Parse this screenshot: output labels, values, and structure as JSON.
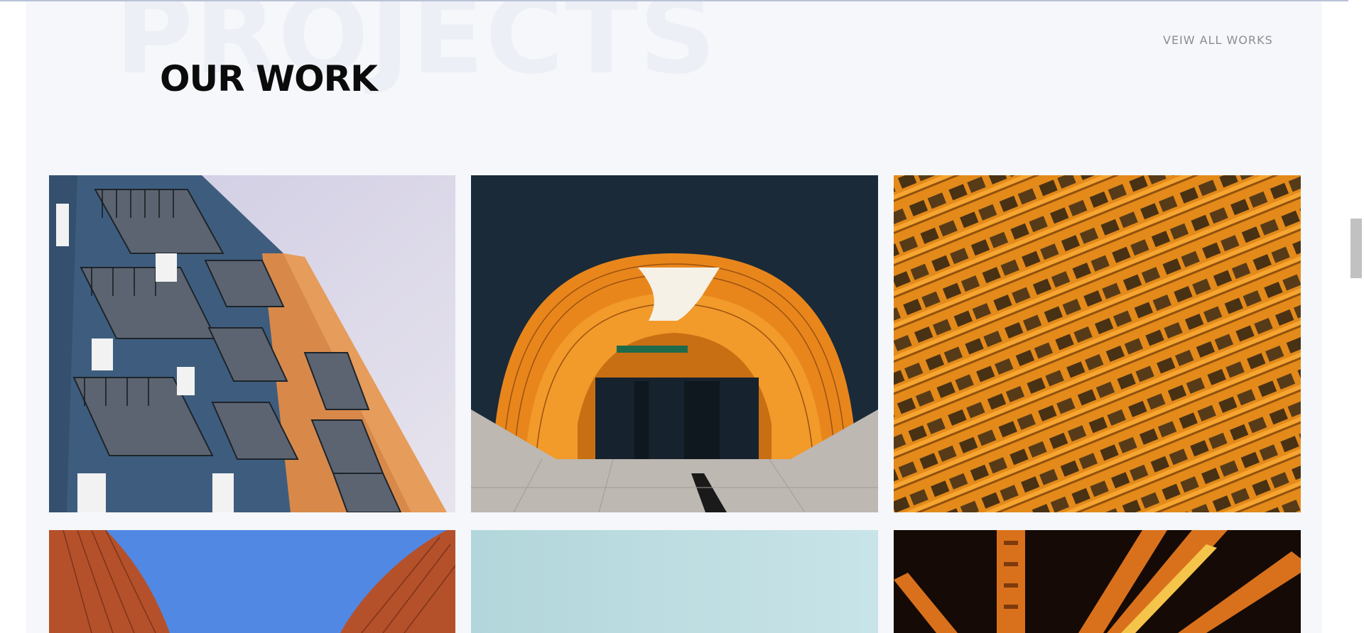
{
  "section": {
    "background_word": "PROJECTS",
    "title": "OUR WORK",
    "view_all_label": "VEIW ALL WORKS"
  },
  "gallery": {
    "items": [
      {
        "name": "project-balconies-blue-orange"
      },
      {
        "name": "project-orange-tunnel-station"
      },
      {
        "name": "project-orange-building-facade"
      },
      {
        "name": "project-curved-red-buildings"
      },
      {
        "name": "project-pale-sky"
      },
      {
        "name": "project-orange-steel-bridge"
      }
    ]
  },
  "colors": {
    "section_bg": "#f5f7fb",
    "title": "#0b0b0b",
    "link": "#8a8d93",
    "accent_orange": "#f0901e"
  }
}
